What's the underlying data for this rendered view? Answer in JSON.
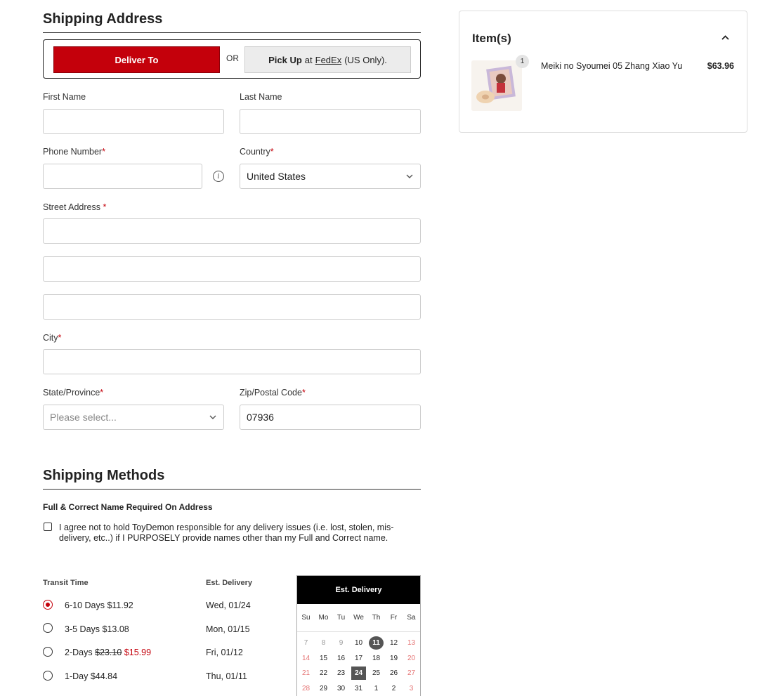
{
  "shipping_address": {
    "title": "Shipping Address",
    "deliver_to_label": "Deliver To",
    "or_label": "OR",
    "pickup": {
      "prefix": "Pick Up",
      "at": "at",
      "carrier": "FedEx",
      "suffix": "(US Only)."
    },
    "first_name": {
      "label": "First Name",
      "value": ""
    },
    "last_name": {
      "label": "Last Name",
      "value": ""
    },
    "phone": {
      "label": "Phone Number",
      "required_mark": "*",
      "value": ""
    },
    "country": {
      "label": "Country",
      "required_mark": "*",
      "value": "United States"
    },
    "street": {
      "label": "Street Address",
      "required_mark": "*",
      "line1": "",
      "line2": "",
      "line3": ""
    },
    "city": {
      "label": "City",
      "required_mark": "*",
      "value": ""
    },
    "state": {
      "label": "State/Province",
      "required_mark": "*",
      "placeholder": "Please select..."
    },
    "zip": {
      "label": "Zip/Postal Code",
      "required_mark": "*",
      "value": "07936"
    }
  },
  "shipping_methods": {
    "title": "Shipping Methods",
    "warning_title": "Full & Correct Name Required On Address",
    "agreement": "I agree not to hold ToyDemon responsible for any delivery issues (i.e. lost, stolen, mis-delivery, etc..) if I PURPOSELY provide names other than my Full and Correct name.",
    "agreement_checked": false,
    "transit_header": "Transit Time",
    "est_header": "Est. Delivery",
    "options": [
      {
        "label": "6-10 Days $11.92",
        "est": "Wed, 01/24",
        "selected": true
      },
      {
        "label": "3-5 Days $13.08",
        "est": "Mon, 01/15",
        "selected": false
      },
      {
        "label_prefix": "2-Days",
        "original_price": "$23.10",
        "sale_price": "$15.99",
        "est": "Fri, 01/12",
        "selected": false
      },
      {
        "label": "1-Day $44.84",
        "est": "Thu, 01/11",
        "selected": false
      }
    ]
  },
  "calendar": {
    "title": "Est. Delivery",
    "weekdays": [
      "Su",
      "Mo",
      "Tu",
      "We",
      "Th",
      "Fr",
      "Sa"
    ],
    "days": [
      [
        "7",
        "8",
        "9",
        "10",
        "11",
        "12",
        "13"
      ],
      [
        "14",
        "15",
        "16",
        "17",
        "18",
        "19",
        "20"
      ],
      [
        "21",
        "22",
        "23",
        "24",
        "25",
        "26",
        "27"
      ],
      [
        "28",
        "29",
        "30",
        "31",
        "1",
        "2",
        "3"
      ]
    ],
    "today": "11",
    "selected": "24",
    "muted_before": [
      "7",
      "8",
      "9"
    ]
  },
  "cart": {
    "title": "Item(s)",
    "items": [
      {
        "quantity": "1",
        "name": "Meiki no Syoumei 05 Zhang Xiao Yu",
        "price": "$63.96"
      }
    ]
  },
  "colors": {
    "accent": "#c4000b",
    "calendar_header": "#000000",
    "weekend": "#e57373"
  }
}
